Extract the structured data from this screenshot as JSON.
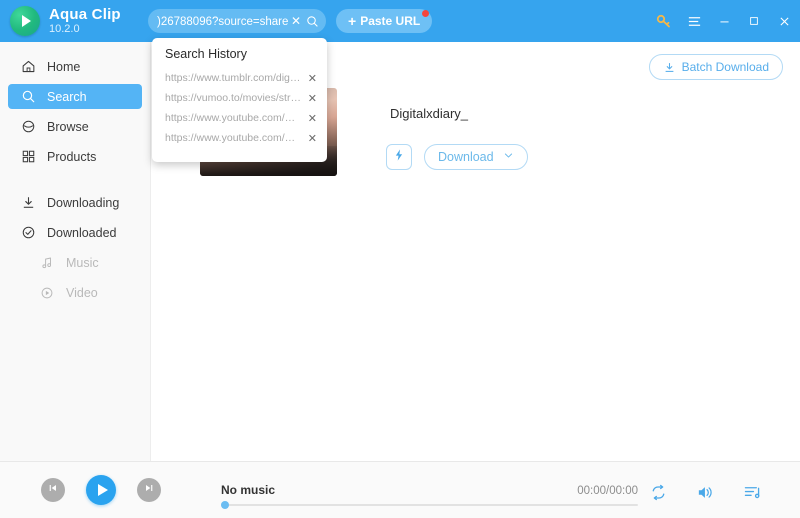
{
  "app": {
    "brand_name": "Aqua Clip",
    "version": "10.2.0",
    "logo_icon": "play-circle-logo"
  },
  "titlebar": {
    "search": {
      "value": ")26788096?source=share",
      "clear_icon": "close-icon",
      "search_icon": "magnifier-icon"
    },
    "paste_button": {
      "label": "Paste URL",
      "plus": "+",
      "badge_color": "#f4453c"
    },
    "window_controls": [
      {
        "name": "key-icon",
        "glyph": "key",
        "color": "#f3b84a"
      },
      {
        "name": "menu-icon",
        "glyph": "hamburger",
        "color": "#ffffff"
      },
      {
        "name": "minimize-icon",
        "glyph": "minimize",
        "color": "#ffffff"
      },
      {
        "name": "maximize-icon",
        "glyph": "maximize",
        "color": "#ffffff"
      },
      {
        "name": "close-icon",
        "glyph": "close",
        "color": "#ffffff"
      }
    ]
  },
  "search_history": {
    "title": "Search History",
    "items": [
      {
        "url": "https://www.tumblr.com/digita...",
        "remove_icon": "close-icon"
      },
      {
        "url": "https://vumoo.to/movies/stra...",
        "remove_icon": "close-icon"
      },
      {
        "url": "https://www.youtube.com/wat...",
        "remove_icon": "close-icon"
      },
      {
        "url": "https://www.youtube.com/wat...",
        "remove_icon": "close-icon"
      }
    ]
  },
  "sidebar": {
    "items": [
      {
        "label": "Home",
        "icon": "home-icon",
        "active": false,
        "sub": false
      },
      {
        "label": "Search",
        "icon": "search-icon",
        "active": true,
        "sub": false
      },
      {
        "label": "Browse",
        "icon": "compass-icon",
        "active": false,
        "sub": false
      },
      {
        "label": "Products",
        "icon": "grid-icon",
        "active": false,
        "sub": false
      },
      {
        "label": "Downloading",
        "icon": "download-icon",
        "active": false,
        "sub": false
      },
      {
        "label": "Downloaded",
        "icon": "check-circle-icon",
        "active": false,
        "sub": false
      },
      {
        "label": "Music",
        "icon": "music-note-icon",
        "active": false,
        "sub": true
      },
      {
        "label": "Video",
        "icon": "video-play-icon",
        "active": false,
        "sub": true
      }
    ]
  },
  "main": {
    "batch_download": {
      "label": "Batch Download",
      "icon": "download-icon"
    },
    "result": {
      "title": "Digitalxdiary_",
      "quick_download_icon": "lightning-bolt-icon",
      "download_label": "Download",
      "download_caret_icon": "chevron-down-icon"
    }
  },
  "player": {
    "previous_icon": "skip-previous-icon",
    "play_icon": "play-icon",
    "next_icon": "skip-next-icon",
    "track_name": "No music",
    "time": "00:00/00:00",
    "progress_percent": 0,
    "repeat_icon": "repeat-icon",
    "volume_icon": "volume-icon",
    "playlist_icon": "playlist-icon"
  },
  "colors": {
    "header_blue": "#36a4ee",
    "accent_blue": "#54b4f5",
    "sidebar_bg": "#f9f9f9",
    "player_bg": "#fafafa"
  }
}
